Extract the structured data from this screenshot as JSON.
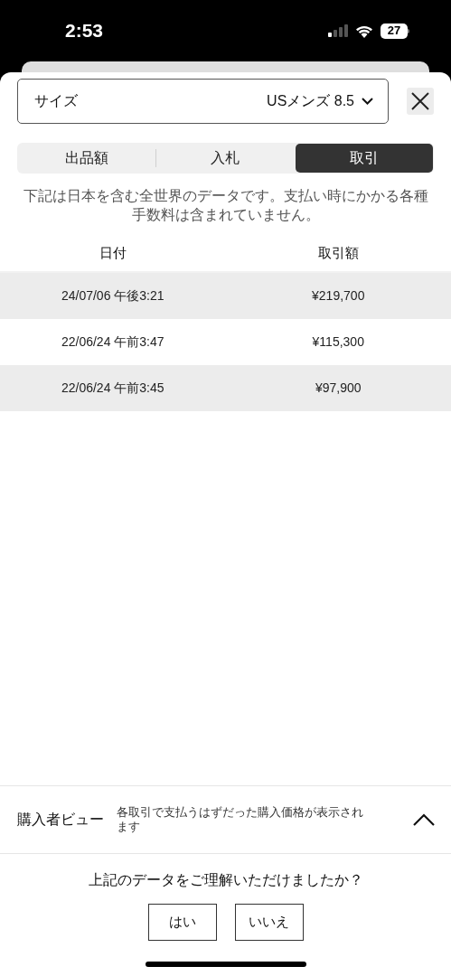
{
  "status_bar": {
    "time": "2:53",
    "battery": "27"
  },
  "size_selector": {
    "label": "サイズ",
    "value": "USメンズ 8.5"
  },
  "tabs": [
    {
      "label": "出品額",
      "selected": false
    },
    {
      "label": "入札",
      "selected": false
    },
    {
      "label": "取引",
      "selected": true
    }
  ],
  "notice": "下記は日本を含む全世界のデータです。支払い時にかかる各種手数料は含まれていません。",
  "table": {
    "columns": [
      "日付",
      "取引額"
    ],
    "rows": [
      [
        "24/07/06 午後3:21",
        "¥219,700"
      ],
      [
        "22/06/24 午前3:47",
        "¥115,300"
      ],
      [
        "22/06/24 午前3:45",
        "¥97,900"
      ]
    ]
  },
  "buyer_view": {
    "title": "購入者ビュー",
    "description": "各取引で支払うはずだった購入価格が表示されます"
  },
  "question": "上記のデータをご理解いただけましたか？",
  "buttons": [
    "はい",
    "いいえ"
  ]
}
